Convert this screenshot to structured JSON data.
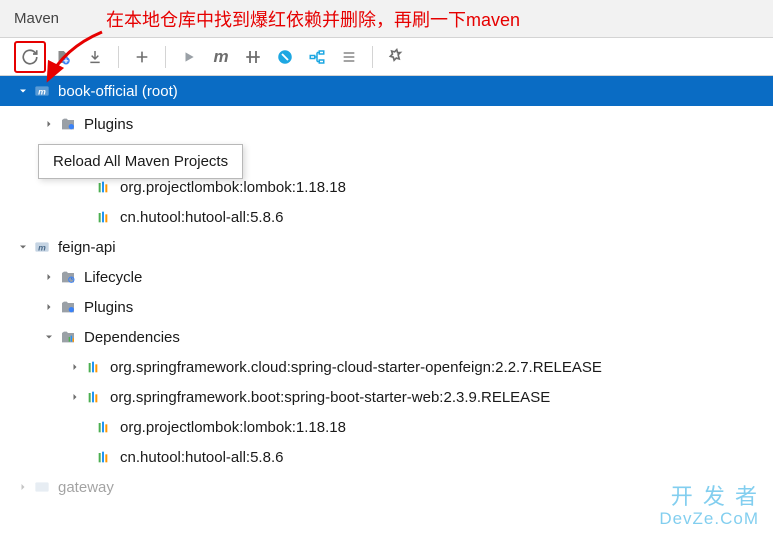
{
  "panel": {
    "title": "Maven"
  },
  "annotation": {
    "text": "在本地仓库中找到爆红依赖并删除，再刷一下maven"
  },
  "tooltip": {
    "text": "Reload All Maven Projects"
  },
  "toolbar": {
    "reload": "reload",
    "build": "build",
    "download": "download",
    "add": "add",
    "run": "run",
    "m": "m",
    "skip": "skip",
    "offline": "offline",
    "show_deps": "show-deps",
    "collapse": "collapse",
    "settings": "settings"
  },
  "tree": {
    "root": {
      "label": "book-official (root)"
    },
    "plugins_label": "Plugins",
    "lifecycle_label": "Lifecycle",
    "dependencies_label": "Dependencies",
    "deps1": [
      "org.projectlombok:lombok:1.18.18",
      "cn.hutool:hutool-all:5.8.6"
    ],
    "module2": {
      "label": "feign-api"
    },
    "deps2": [
      "org.springframework.cloud:spring-cloud-starter-openfeign:2.2.7.RELEASE",
      "org.springframework.boot:spring-boot-starter-web:2.3.9.RELEASE",
      "org.projectlombok:lombok:1.18.18",
      "cn.hutool:hutool-all:5.8.6"
    ],
    "module3": {
      "label": "gateway"
    }
  },
  "watermark": {
    "line1": "开 发 者",
    "line2": "DevZe.CoM"
  }
}
